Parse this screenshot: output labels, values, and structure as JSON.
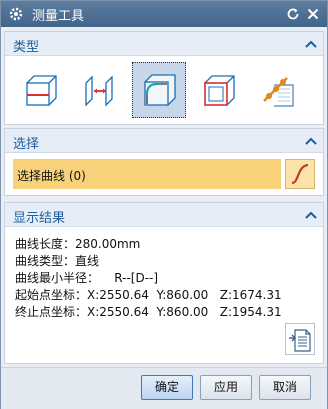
{
  "window": {
    "title": "测量工具",
    "icons": {
      "app": "gear-icon",
      "reset": "reset-icon",
      "close": "close-icon"
    }
  },
  "type_section": {
    "title": "类型",
    "items": [
      {
        "name": "measure-point-to-point-icon"
      },
      {
        "name": "measure-distance-icon"
      },
      {
        "name": "measure-curve-length-icon",
        "selected": true
      },
      {
        "name": "measure-face-icon"
      },
      {
        "name": "measure-angle-icon"
      }
    ]
  },
  "select_section": {
    "title": "选择",
    "select_label": "选择曲线 (0)",
    "highlight_color": "#f8d27b"
  },
  "result_section": {
    "title": "显示结果",
    "lines": [
      "曲线长度：280.00mm",
      "曲线类型：直线",
      "曲线最小半径：    R--[D--]",
      "起始点坐标：X:2550.64  Y:860.00   Z:1674.31",
      "终止点坐标：X:2550.64  Y:860.00   Z:1954.31"
    ]
  },
  "buttons": {
    "ok": "确定",
    "apply": "应用",
    "cancel": "取消"
  },
  "colors": {
    "titlebar": "#4a6d92",
    "section_title": "#1f5d9b",
    "accent": "#3d78b8"
  }
}
